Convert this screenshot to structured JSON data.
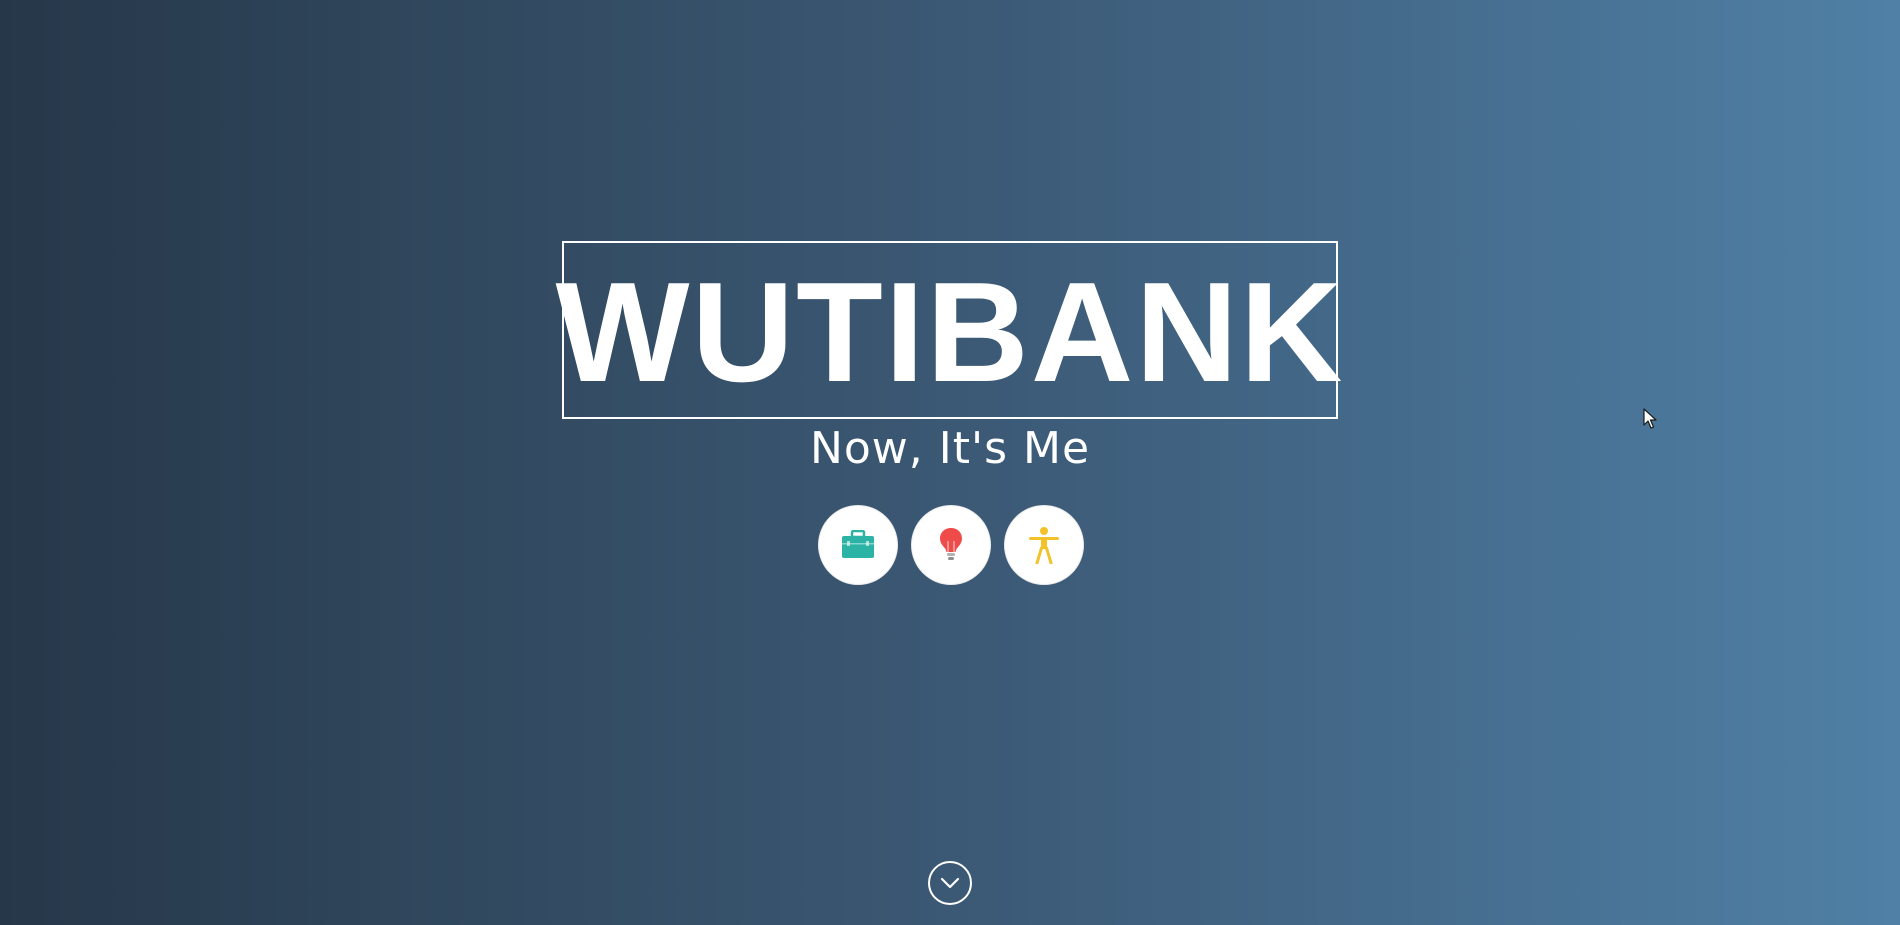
{
  "hero": {
    "title": "WUTIBANK",
    "subtitle": "Now, It's Me"
  },
  "icons": [
    {
      "name": "briefcase-icon",
      "color": "#2bb3a6"
    },
    {
      "name": "lightbulb-icon",
      "color": "#ef4b4b"
    },
    {
      "name": "accessibility-icon",
      "color": "#f3c228"
    }
  ],
  "scroll": {
    "icon": "chevron-down-icon",
    "color": "#ffffff"
  },
  "colors": {
    "background_left": "#263749",
    "background_right": "#5080a6",
    "text": "#ffffff"
  }
}
